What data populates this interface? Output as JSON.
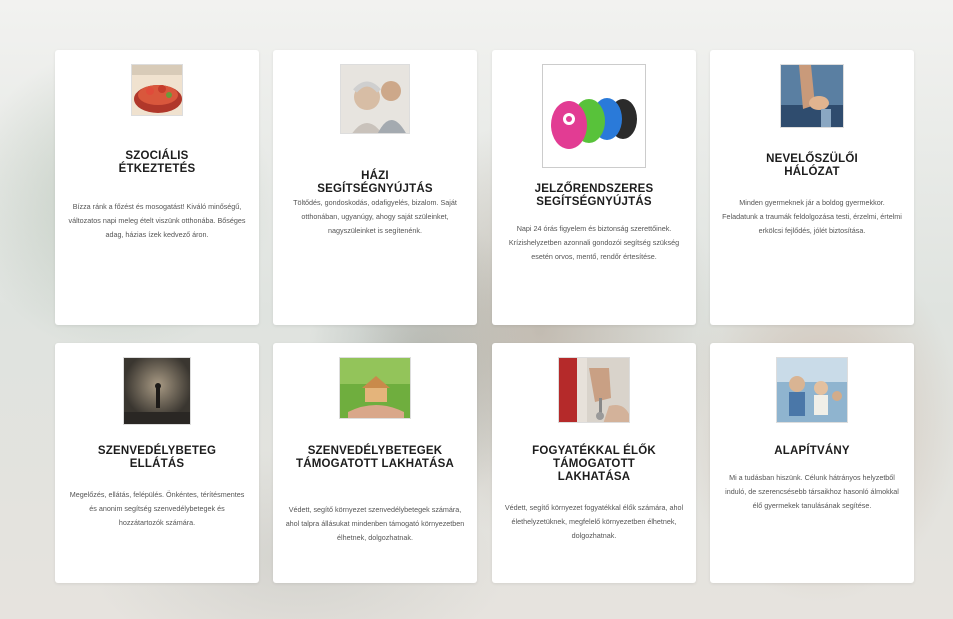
{
  "cards": [
    {
      "title": "SZOCIÁLIS ÉTKEZTETÉS",
      "icon": "food-icon",
      "text": "Bízza ránk a főzést és mosogatást! Kiváló minőségű, változatos napi meleg ételt viszünk otthonába. Bőséges adag, házias ízek kedvező áron."
    },
    {
      "title": "HÁZI SEGÍTSÉGNYÚJTÁS",
      "icon": "elderly-care-icon",
      "text": "Töltődés, gondoskodás, odafigyelés, bizalom. Saját otthonában, ugyanúgy, ahogy saját szüleinket, nagyszüleinket is segítenénk."
    },
    {
      "title": "JELZŐRENDSZERES SEGÍTSÉGNYÚJTÁS",
      "icon": "alarm-device-icon",
      "text": "Napi 24 órás figyelem és biztonság szerettőinek. Krízishelyzetben azonnali gondozói segítség szükség esetén orvos, mentő, rendőr értesítése."
    },
    {
      "title": "NEVELŐSZÜLŐI HÁLÓZAT",
      "icon": "family-icon",
      "text": "Minden gyermeknek jár a boldog gyermekkor. Feladatunk a traumák feldolgozása testi, érzelmi, értelmi erkölcsi fejlődés, jólét biztosítása."
    },
    {
      "title": "SZENVEDÉLYBETEG ELLÁTÁS",
      "icon": "addiction-care-icon",
      "text": "Megelőzés, ellátás, felépülés. Önkéntes, térítésmentes és anonim segítség szenvedélybetegek és hozzátartozók számára."
    },
    {
      "title": "SZENVEDÉLYBETEGEK TÁMOGATOTT LAKHATÁSA",
      "icon": "house-in-hands-icon",
      "text": "Védett, segítő környezet szenvedélybetegek számára, ahol talpra állásukat mindenben támogató környezetben élhetnek, dolgozhatnak."
    },
    {
      "title": "FOGYATÉKKAL ÉLŐK TÁMOGATOTT LAKHATÁSA",
      "icon": "keys-icon",
      "text": "Védett, segítő környezet fogyatékkal élők számára, ahol élethelyzetüknek, megfelelő környezetben élhetnek, dolgozhatnak."
    },
    {
      "title": "ALAPÍTVÁNY",
      "icon": "children-icon",
      "text": "Mi a tudásban hiszünk. Célunk hátrányos helyzetből induló, de szerencsésebb társaikhoz hasonló álmokkal élő gyermekek tanulásának segítése."
    }
  ]
}
